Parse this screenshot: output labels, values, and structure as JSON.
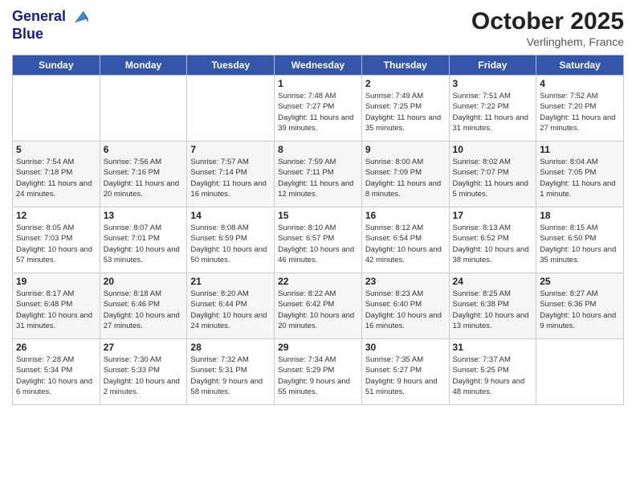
{
  "header": {
    "logo_line1": "General",
    "logo_line2": "Blue",
    "month_title": "October 2025",
    "location": "Verlinghem, France"
  },
  "weekdays": [
    "Sunday",
    "Monday",
    "Tuesday",
    "Wednesday",
    "Thursday",
    "Friday",
    "Saturday"
  ],
  "weeks": [
    [
      {
        "day": "",
        "sunrise": "",
        "sunset": "",
        "daylight": ""
      },
      {
        "day": "",
        "sunrise": "",
        "sunset": "",
        "daylight": ""
      },
      {
        "day": "",
        "sunrise": "",
        "sunset": "",
        "daylight": ""
      },
      {
        "day": "1",
        "sunrise": "Sunrise: 7:48 AM",
        "sunset": "Sunset: 7:27 PM",
        "daylight": "Daylight: 11 hours and 39 minutes."
      },
      {
        "day": "2",
        "sunrise": "Sunrise: 7:49 AM",
        "sunset": "Sunset: 7:25 PM",
        "daylight": "Daylight: 11 hours and 35 minutes."
      },
      {
        "day": "3",
        "sunrise": "Sunrise: 7:51 AM",
        "sunset": "Sunset: 7:22 PM",
        "daylight": "Daylight: 11 hours and 31 minutes."
      },
      {
        "day": "4",
        "sunrise": "Sunrise: 7:52 AM",
        "sunset": "Sunset: 7:20 PM",
        "daylight": "Daylight: 11 hours and 27 minutes."
      }
    ],
    [
      {
        "day": "5",
        "sunrise": "Sunrise: 7:54 AM",
        "sunset": "Sunset: 7:18 PM",
        "daylight": "Daylight: 11 hours and 24 minutes."
      },
      {
        "day": "6",
        "sunrise": "Sunrise: 7:56 AM",
        "sunset": "Sunset: 7:16 PM",
        "daylight": "Daylight: 11 hours and 20 minutes."
      },
      {
        "day": "7",
        "sunrise": "Sunrise: 7:57 AM",
        "sunset": "Sunset: 7:14 PM",
        "daylight": "Daylight: 11 hours and 16 minutes."
      },
      {
        "day": "8",
        "sunrise": "Sunrise: 7:59 AM",
        "sunset": "Sunset: 7:11 PM",
        "daylight": "Daylight: 11 hours and 12 minutes."
      },
      {
        "day": "9",
        "sunrise": "Sunrise: 8:00 AM",
        "sunset": "Sunset: 7:09 PM",
        "daylight": "Daylight: 11 hours and 8 minutes."
      },
      {
        "day": "10",
        "sunrise": "Sunrise: 8:02 AM",
        "sunset": "Sunset: 7:07 PM",
        "daylight": "Daylight: 11 hours and 5 minutes."
      },
      {
        "day": "11",
        "sunrise": "Sunrise: 8:04 AM",
        "sunset": "Sunset: 7:05 PM",
        "daylight": "Daylight: 11 hours and 1 minute."
      }
    ],
    [
      {
        "day": "12",
        "sunrise": "Sunrise: 8:05 AM",
        "sunset": "Sunset: 7:03 PM",
        "daylight": "Daylight: 10 hours and 57 minutes."
      },
      {
        "day": "13",
        "sunrise": "Sunrise: 8:07 AM",
        "sunset": "Sunset: 7:01 PM",
        "daylight": "Daylight: 10 hours and 53 minutes."
      },
      {
        "day": "14",
        "sunrise": "Sunrise: 8:08 AM",
        "sunset": "Sunset: 6:59 PM",
        "daylight": "Daylight: 10 hours and 50 minutes."
      },
      {
        "day": "15",
        "sunrise": "Sunrise: 8:10 AM",
        "sunset": "Sunset: 6:57 PM",
        "daylight": "Daylight: 10 hours and 46 minutes."
      },
      {
        "day": "16",
        "sunrise": "Sunrise: 8:12 AM",
        "sunset": "Sunset: 6:54 PM",
        "daylight": "Daylight: 10 hours and 42 minutes."
      },
      {
        "day": "17",
        "sunrise": "Sunrise: 8:13 AM",
        "sunset": "Sunset: 6:52 PM",
        "daylight": "Daylight: 10 hours and 38 minutes."
      },
      {
        "day": "18",
        "sunrise": "Sunrise: 8:15 AM",
        "sunset": "Sunset: 6:50 PM",
        "daylight": "Daylight: 10 hours and 35 minutes."
      }
    ],
    [
      {
        "day": "19",
        "sunrise": "Sunrise: 8:17 AM",
        "sunset": "Sunset: 6:48 PM",
        "daylight": "Daylight: 10 hours and 31 minutes."
      },
      {
        "day": "20",
        "sunrise": "Sunrise: 8:18 AM",
        "sunset": "Sunset: 6:46 PM",
        "daylight": "Daylight: 10 hours and 27 minutes."
      },
      {
        "day": "21",
        "sunrise": "Sunrise: 8:20 AM",
        "sunset": "Sunset: 6:44 PM",
        "daylight": "Daylight: 10 hours and 24 minutes."
      },
      {
        "day": "22",
        "sunrise": "Sunrise: 8:22 AM",
        "sunset": "Sunset: 6:42 PM",
        "daylight": "Daylight: 10 hours and 20 minutes."
      },
      {
        "day": "23",
        "sunrise": "Sunrise: 8:23 AM",
        "sunset": "Sunset: 6:40 PM",
        "daylight": "Daylight: 10 hours and 16 minutes."
      },
      {
        "day": "24",
        "sunrise": "Sunrise: 8:25 AM",
        "sunset": "Sunset: 6:38 PM",
        "daylight": "Daylight: 10 hours and 13 minutes."
      },
      {
        "day": "25",
        "sunrise": "Sunrise: 8:27 AM",
        "sunset": "Sunset: 6:36 PM",
        "daylight": "Daylight: 10 hours and 9 minutes."
      }
    ],
    [
      {
        "day": "26",
        "sunrise": "Sunrise: 7:28 AM",
        "sunset": "Sunset: 5:34 PM",
        "daylight": "Daylight: 10 hours and 6 minutes."
      },
      {
        "day": "27",
        "sunrise": "Sunrise: 7:30 AM",
        "sunset": "Sunset: 5:33 PM",
        "daylight": "Daylight: 10 hours and 2 minutes."
      },
      {
        "day": "28",
        "sunrise": "Sunrise: 7:32 AM",
        "sunset": "Sunset: 5:31 PM",
        "daylight": "Daylight: 9 hours and 58 minutes."
      },
      {
        "day": "29",
        "sunrise": "Sunrise: 7:34 AM",
        "sunset": "Sunset: 5:29 PM",
        "daylight": "Daylight: 9 hours and 55 minutes."
      },
      {
        "day": "30",
        "sunrise": "Sunrise: 7:35 AM",
        "sunset": "Sunset: 5:27 PM",
        "daylight": "Daylight: 9 hours and 51 minutes."
      },
      {
        "day": "31",
        "sunrise": "Sunrise: 7:37 AM",
        "sunset": "Sunset: 5:25 PM",
        "daylight": "Daylight: 9 hours and 48 minutes."
      },
      {
        "day": "",
        "sunrise": "",
        "sunset": "",
        "daylight": ""
      }
    ]
  ]
}
